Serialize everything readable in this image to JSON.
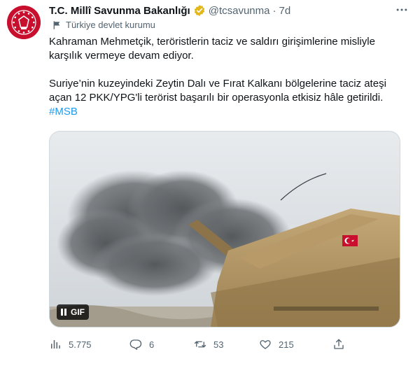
{
  "tweet": {
    "account_name": "T.C. Millî Savunma Bakanlığı",
    "handle": "@tcsavunma",
    "separator": "·",
    "time": "7d",
    "label": "Türkiye devlet kurumu",
    "text_line_1": "Kahraman Mehmetçik, teröristlerin taciz ve saldırı girişimlerine misliyle",
    "text_line_2": "karşılık vermeye devam ediyor.",
    "text_line_3": "Suriye’nin kuzeyindeki Zeytin Dalı ve Fırat Kalkanı bölgelerine taciz ateşi",
    "text_line_4": "açan 12 PKK/YPG'li terörist başarılı bir operasyonla etkisiz hâle getirildi.",
    "hashtag": "#MSB",
    "media_badge": "GIF"
  },
  "metrics": {
    "views": "5.775",
    "replies": "6",
    "retweets": "53",
    "likes": "215"
  },
  "icons": {
    "avatar": "msb-emblem-icon",
    "verified": "verified-badge-icon",
    "label": "government-flag-icon",
    "more": "more-options-icon",
    "views": "analytics-icon",
    "reply": "reply-icon",
    "retweet": "retweet-icon",
    "like": "heart-icon",
    "share": "share-icon"
  },
  "colors": {
    "accent": "#1d9bf0",
    "avatar_bg": "#c8102e",
    "verified_gold": "#e2b719",
    "secondary_text": "#536471"
  }
}
